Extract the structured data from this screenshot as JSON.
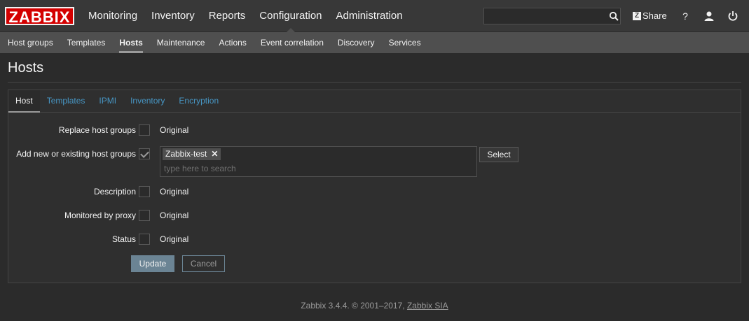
{
  "logo": "ZABBIX",
  "top_menu": [
    "Monitoring",
    "Inventory",
    "Reports",
    "Configuration",
    "Administration"
  ],
  "search": {
    "value": ""
  },
  "share_label": "Share",
  "help_glyph": "?",
  "sub_menu": [
    "Host groups",
    "Templates",
    "Hosts",
    "Maintenance",
    "Actions",
    "Event correlation",
    "Discovery",
    "Services"
  ],
  "page_title": "Hosts",
  "tabs": [
    "Host",
    "Templates",
    "IPMI",
    "Inventory",
    "Encryption"
  ],
  "form": {
    "replace_host_groups": {
      "label": "Replace host groups",
      "checked": false,
      "value": "Original"
    },
    "add_host_groups": {
      "label": "Add new or existing host groups",
      "checked": true,
      "chip": "Zabbix-test",
      "placeholder": "type here to search",
      "select_label": "Select"
    },
    "description": {
      "label": "Description",
      "checked": false,
      "value": "Original"
    },
    "monitored_by_proxy": {
      "label": "Monitored by proxy",
      "checked": false,
      "value": "Original"
    },
    "status": {
      "label": "Status",
      "checked": false,
      "value": "Original"
    },
    "update_label": "Update",
    "cancel_label": "Cancel"
  },
  "footer": {
    "text": "Zabbix 3.4.4. © 2001–2017,",
    "link": "Zabbix SIA"
  },
  "colors": {
    "accent": "#4796c4",
    "logo_red": "#d40000",
    "primary_button": "#6b8494"
  }
}
